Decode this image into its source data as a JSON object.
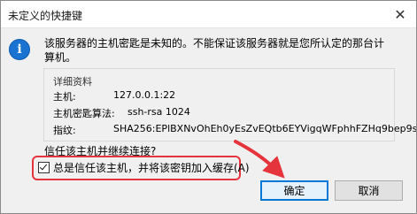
{
  "window": {
    "title": "未定义的快捷键",
    "close_glyph": "✕"
  },
  "message": {
    "icon_glyph": "i",
    "text": "该服务器的主机密匙是未知的。不能保证该服务器就是您所认定的那台计算机。"
  },
  "details": {
    "legend": "详细资料",
    "rows": [
      {
        "label": "主机:",
        "value": "127.0.0.1:22"
      },
      {
        "label": "主机密匙算法:",
        "value": "ssh-rsa 1024"
      },
      {
        "label": "指纹:",
        "value": "SHA256:EPlBXNvOhEh0yEsZvEQtb6EYVigqWFphhFZHq9bep9s"
      }
    ]
  },
  "question": "信任该主机并继续连接?",
  "checkbox": {
    "label": "总是信任该主机，并将该密钥加入缓存(A)",
    "checked": true
  },
  "buttons": {
    "ok": "确定",
    "cancel": "取消"
  },
  "annotation_color": "#e6343c"
}
